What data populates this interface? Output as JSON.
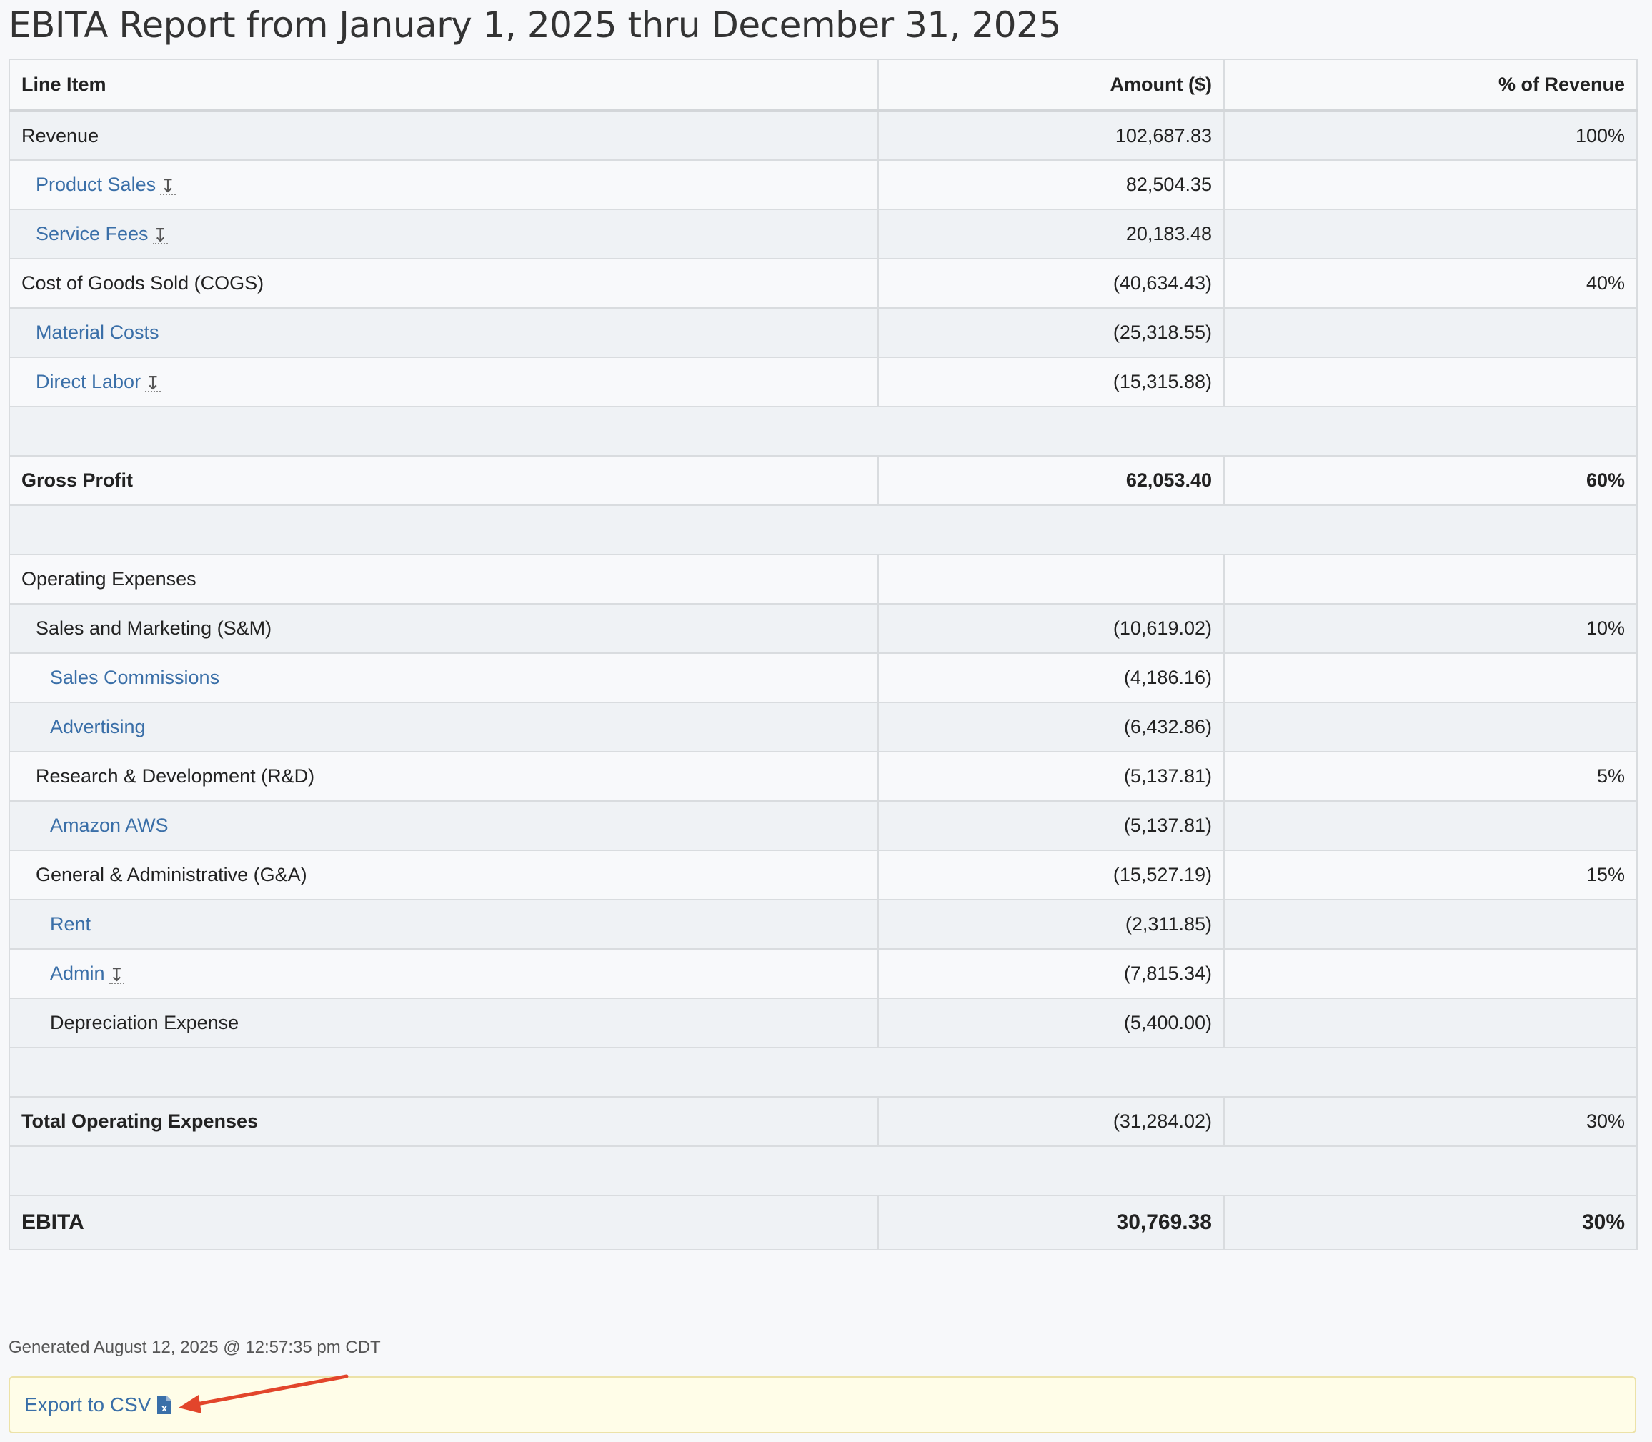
{
  "title": "EBITA Report from January 1, 2025 thru December 31, 2025",
  "headers": {
    "line_item": "Line Item",
    "amount": "Amount ($)",
    "percent": "% of Revenue"
  },
  "rows": [
    {
      "label": "Revenue",
      "amount": "102,687.83",
      "pct": "100%"
    },
    {
      "label": "Product Sales",
      "amount": "82,504.35",
      "pct": ""
    },
    {
      "label": "Service Fees",
      "amount": "20,183.48",
      "pct": ""
    },
    {
      "label": "Cost of Goods Sold (COGS)",
      "amount": "(40,634.43)",
      "pct": "40%"
    },
    {
      "label": "Material Costs",
      "amount": "(25,318.55)",
      "pct": ""
    },
    {
      "label": "Direct Labor",
      "amount": "(15,315.88)",
      "pct": ""
    },
    {
      "label": "Gross Profit",
      "amount": "62,053.40",
      "pct": "60%"
    },
    {
      "label": "Operating Expenses",
      "amount": "",
      "pct": ""
    },
    {
      "label": "Sales and Marketing (S&M)",
      "amount": "(10,619.02)",
      "pct": "10%"
    },
    {
      "label": "Sales Commissions",
      "amount": "(4,186.16)",
      "pct": ""
    },
    {
      "label": "Advertising",
      "amount": "(6,432.86)",
      "pct": ""
    },
    {
      "label": "Research & Development (R&D)",
      "amount": "(5,137.81)",
      "pct": "5%"
    },
    {
      "label": "Amazon AWS",
      "amount": "(5,137.81)",
      "pct": ""
    },
    {
      "label": "General & Administrative (G&A)",
      "amount": "(15,527.19)",
      "pct": "15%"
    },
    {
      "label": "Rent",
      "amount": "(2,311.85)",
      "pct": ""
    },
    {
      "label": "Admin",
      "amount": "(7,815.34)",
      "pct": ""
    },
    {
      "label": "Depreciation Expense",
      "amount": "(5,400.00)",
      "pct": ""
    },
    {
      "label": "Total Operating Expenses",
      "amount": "(31,284.02)",
      "pct": "30%"
    },
    {
      "label": "EBITA",
      "amount": "30,769.38",
      "pct": "30%"
    }
  ],
  "drill_icon": "↧",
  "generated": "Generated August 12, 2025 @ 12:57:35 pm CDT",
  "export": {
    "label": "Export to CSV",
    "icon": "csv-file-icon"
  },
  "colors": {
    "link": "#3a6fa8",
    "annotation_arrow": "#e2452b",
    "export_bg": "#fffde8"
  }
}
